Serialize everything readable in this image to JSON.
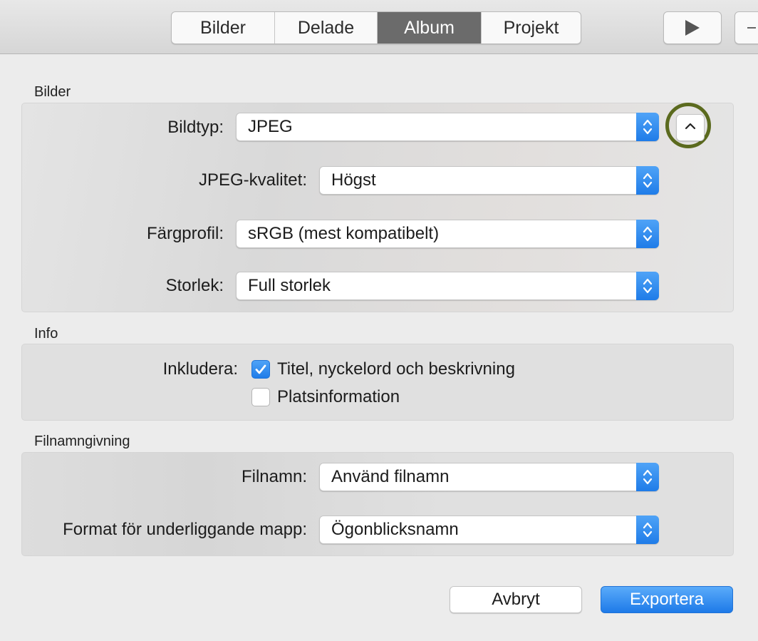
{
  "toolbar": {
    "tabs": [
      {
        "label": "Bilder",
        "active": false
      },
      {
        "label": "Delade",
        "active": false
      },
      {
        "label": "Album",
        "active": true
      },
      {
        "label": "Projekt",
        "active": false
      }
    ],
    "play_icon": "play-icon",
    "extra_icon": "minus-icon"
  },
  "sections": {
    "bilder": {
      "title": "Bilder",
      "rows": {
        "bildtyp": {
          "label": "Bildtyp:",
          "value": "JPEG"
        },
        "jpeg_kvalitet": {
          "label": "JPEG-kvalitet:",
          "value": "Högst"
        },
        "fargprofil": {
          "label": "Färgprofil:",
          "value": "sRGB (mest kompatibelt)"
        },
        "storlek": {
          "label": "Storlek:",
          "value": "Full storlek"
        }
      },
      "collapse_icon": "chevron-up-icon",
      "highlight_color": "#5b6a1e"
    },
    "info": {
      "title": "Info",
      "include_label": "Inkludera:",
      "options": [
        {
          "label": "Titel, nyckelord och beskrivning",
          "checked": true
        },
        {
          "label": "Platsinformation",
          "checked": false
        }
      ]
    },
    "filnamngivning": {
      "title": "Filnamngivning",
      "rows": {
        "filnamn": {
          "label": "Filnamn:",
          "value": "Använd filnamn"
        },
        "mapp": {
          "label": "Format för underliggande mapp:",
          "value": "Ögonblicksnamn"
        }
      }
    }
  },
  "buttons": {
    "cancel": "Avbryt",
    "export": "Exportera"
  },
  "colors": {
    "accent": "#1f7ce8",
    "active_tab": "#6b6b6b"
  }
}
